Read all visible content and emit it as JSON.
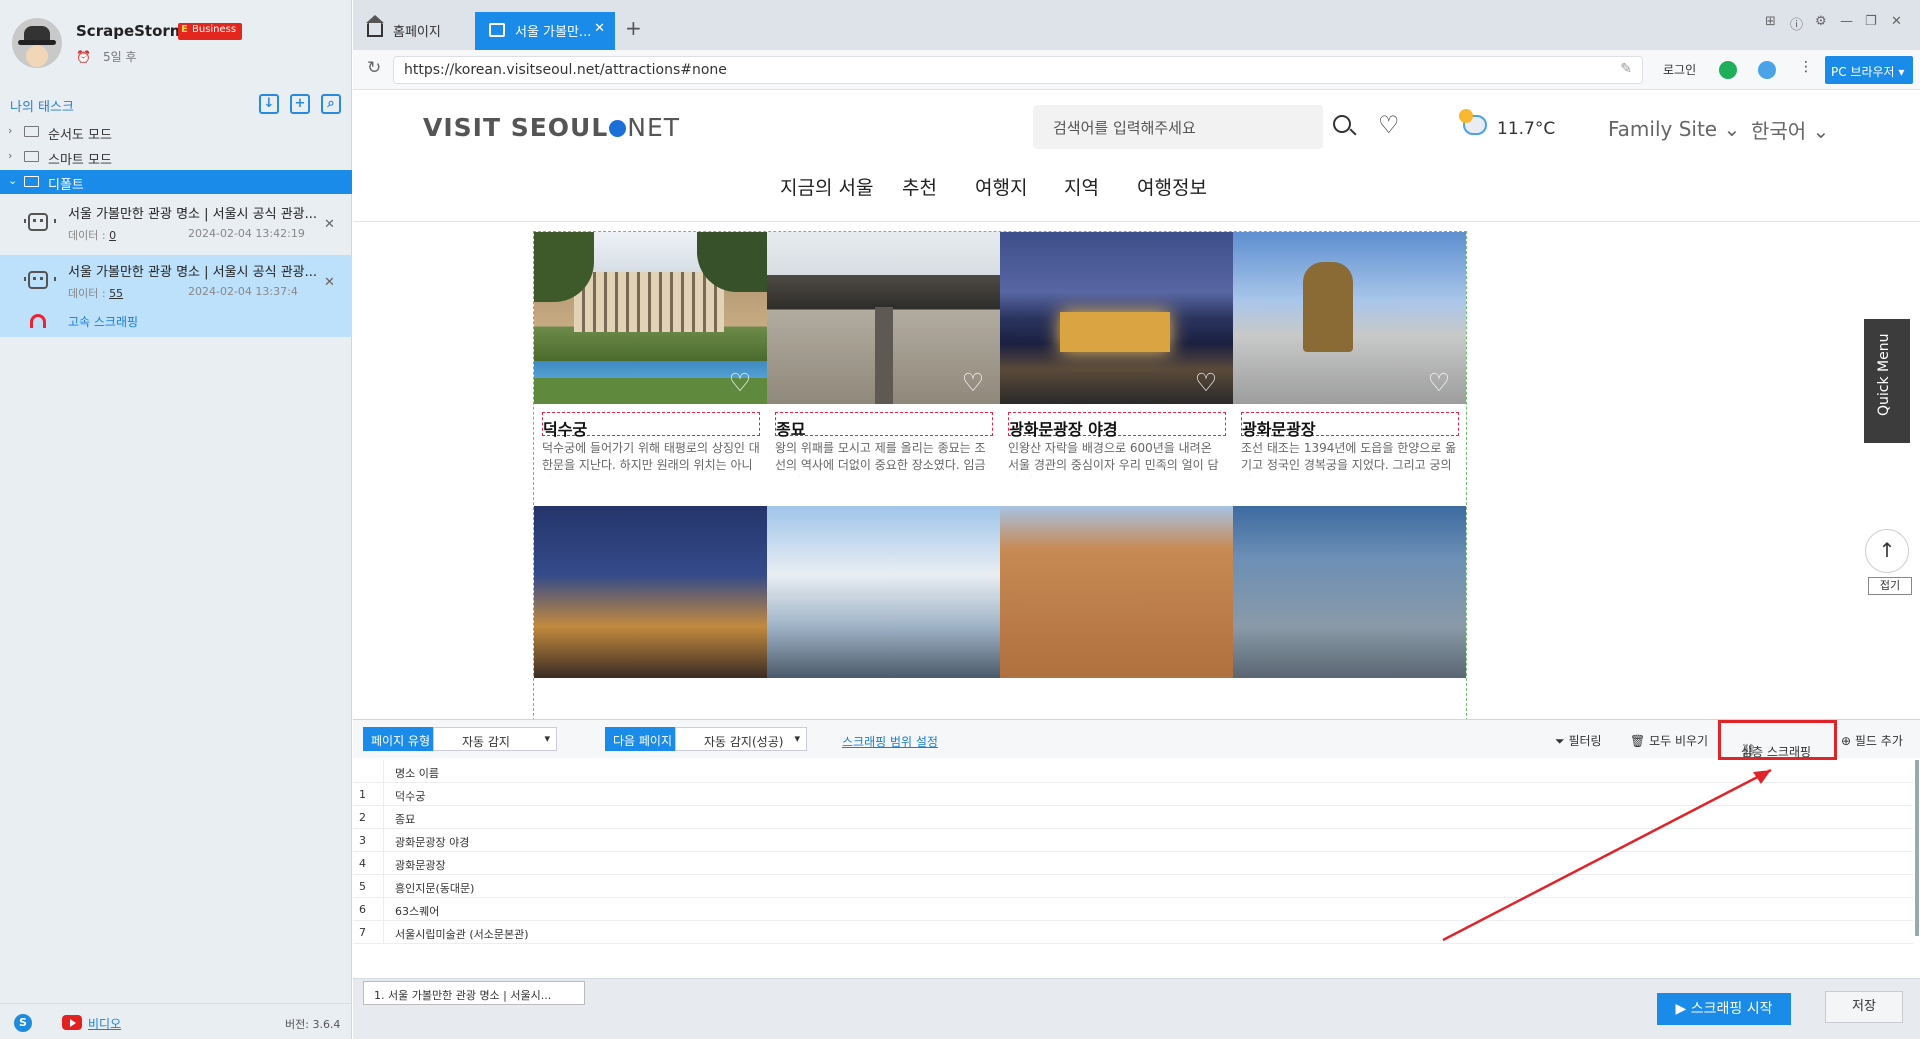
{
  "sidebar": {
    "app_name": "ScrapeStorm",
    "plan_badge": "Business",
    "expiry": "5일 후",
    "tasks_title": "나의 태스크",
    "tree": [
      {
        "label": "순서도 모드"
      },
      {
        "label": "스마트 모드"
      },
      {
        "label": "디폴트"
      }
    ],
    "tasks": [
      {
        "title": "서울 가볼만한 관광 명소 | 서울시 공식 관광...",
        "data_label": "데이터 :",
        "data_count": "0",
        "time": "2024-02-04 13:42:19"
      },
      {
        "title": "서울 가볼만한 관광 명소 | 서울시 공식 관광...",
        "data_label": "데이터 :",
        "data_count": "55",
        "time": "2024-02-04 13:37:4",
        "extra": "고속 스크래핑"
      }
    ],
    "footer": {
      "video": "비디오",
      "version": "버전: 3.6.4"
    }
  },
  "browser": {
    "tabs": [
      {
        "label": "홈페이지"
      },
      {
        "label": "서울 가볼만..."
      }
    ],
    "url": "https://korean.visitseoul.net/attractions#none",
    "login": "로그인",
    "pc_browser": "PC 브라우저 ▾"
  },
  "site": {
    "logo_main": "VISIT SEOUL",
    "logo_net": "NET",
    "search_placeholder": "검색어를 입력해주세요",
    "temperature": "11.7°C",
    "family_site": "Family Site ⌄",
    "language": "한국어 ⌄",
    "nav": [
      "지금의 서울",
      "추천",
      "여행지",
      "지역",
      "여행정보"
    ],
    "quick_menu": "Quick Menu",
    "fold": "접기",
    "cards": [
      {
        "name": "덕수궁",
        "desc": "덕수궁에 들어가기 위해 태평로의 상징인 대한문을 지난다. 하지만 원래의 위치는 아니다. …"
      },
      {
        "name": "종묘",
        "desc": "왕의 위패를 모시고 제를 올리는 종묘는 조선의 역사에 더없이 중요한 장소였다. 임금이 새로…"
      },
      {
        "name": "광화문광장 야경",
        "desc": "인왕산 자락을 배경으로 600년을 내려온 서울 경관의 중심이자 우리 민족의 얼이 담긴 장소"
      },
      {
        "name": "광화문광장",
        "desc": "조선 태조는 1394년에 도읍을 한양으로 옮기고 정국인 경복궁을 지었다. 그리고 궁의 정문…"
      }
    ]
  },
  "panel": {
    "page_type_label": "페이지 유형",
    "page_type_value": "자동 감지",
    "next_page_label": "다음 페이지",
    "next_page_value": "자동 감지(성공)",
    "scope_link": "스크래핑 범위 설정",
    "filter": "필터링",
    "clear_all": "모두 비우기",
    "deep_scrape": "심층 스크래핑",
    "add_field": "필드 추가",
    "column_header": "명소 이름",
    "rows": [
      {
        "idx": "1",
        "name": "덕수궁"
      },
      {
        "idx": "2",
        "name": "종묘"
      },
      {
        "idx": "3",
        "name": "광화문광장 야경"
      },
      {
        "idx": "4",
        "name": "광화문광장"
      },
      {
        "idx": "5",
        "name": "흥인지문(동대문)"
      },
      {
        "idx": "6",
        "name": "63스퀘어"
      },
      {
        "idx": "7",
        "name": "서울시립미술관 (서소문본관)"
      }
    ],
    "footer_tab": "1. 서울 가볼만한 관광 명소 | 서울시...",
    "start_button": "▶ 스크래핑 시작",
    "save_button": "저장"
  }
}
